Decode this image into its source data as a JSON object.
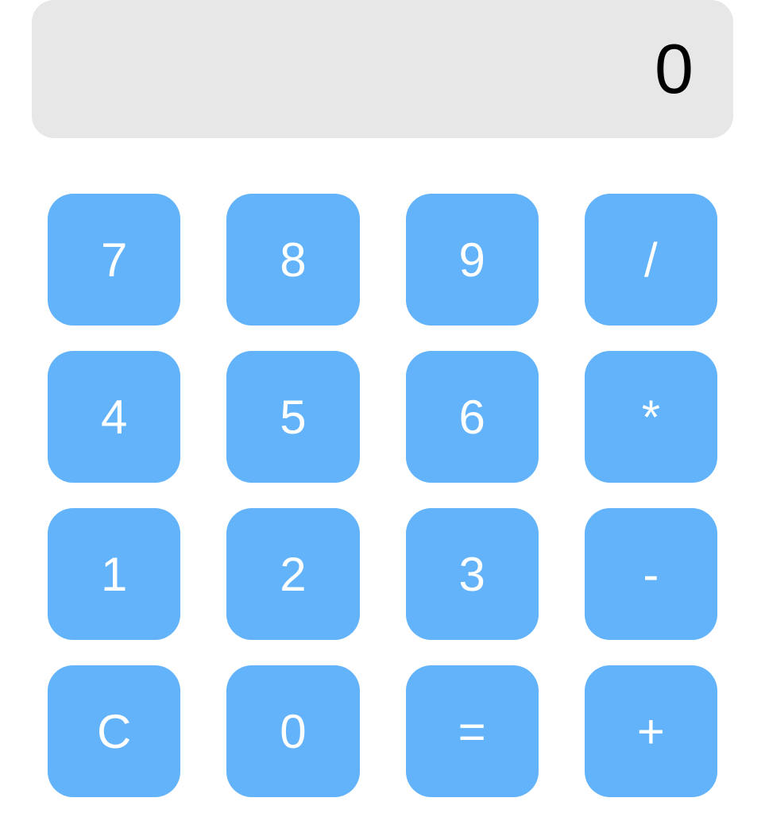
{
  "display": {
    "value": "0"
  },
  "keypad": {
    "rows": [
      [
        {
          "label": "7",
          "name": "key-7"
        },
        {
          "label": "8",
          "name": "key-8"
        },
        {
          "label": "9",
          "name": "key-9"
        },
        {
          "label": "/",
          "name": "key-divide"
        }
      ],
      [
        {
          "label": "4",
          "name": "key-4"
        },
        {
          "label": "5",
          "name": "key-5"
        },
        {
          "label": "6",
          "name": "key-6"
        },
        {
          "label": "*",
          "name": "key-multiply"
        }
      ],
      [
        {
          "label": "1",
          "name": "key-1"
        },
        {
          "label": "2",
          "name": "key-2"
        },
        {
          "label": "3",
          "name": "key-3"
        },
        {
          "label": "-",
          "name": "key-subtract"
        }
      ],
      [
        {
          "label": "C",
          "name": "key-clear"
        },
        {
          "label": "0",
          "name": "key-0"
        },
        {
          "label": "=",
          "name": "key-equals"
        },
        {
          "label": "+",
          "name": "key-add"
        }
      ]
    ]
  },
  "colors": {
    "key_bg": "#62b3fa",
    "key_fg": "#ffffff",
    "display_bg": "#e7e7e7",
    "display_fg": "#000000"
  }
}
